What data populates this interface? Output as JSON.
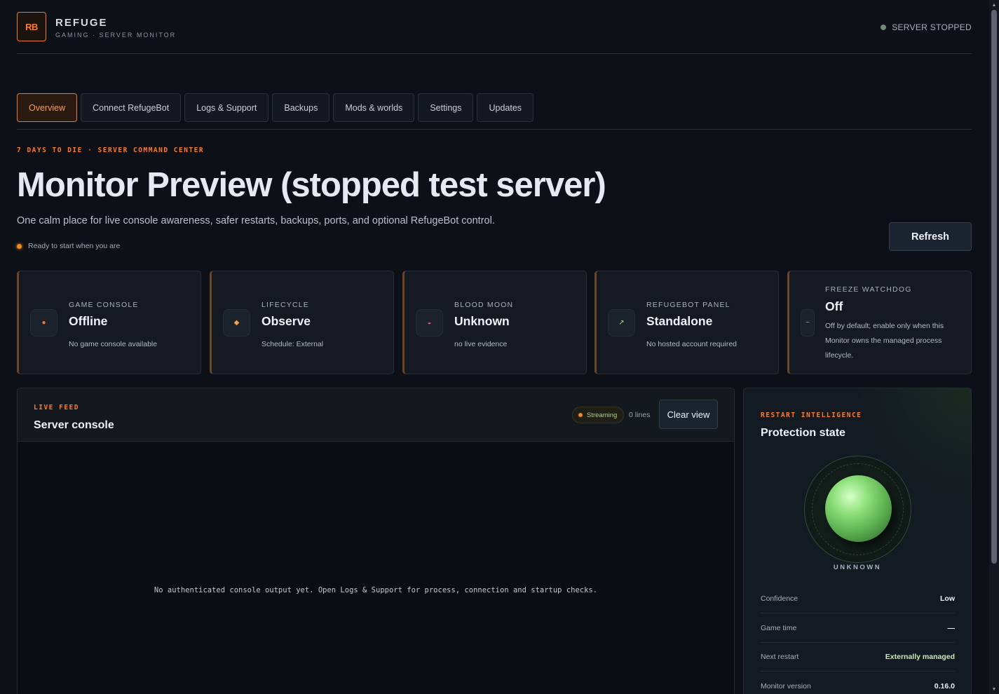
{
  "brand": {
    "logo": "RB",
    "title": "REFUGE",
    "subtitle": "GAMING · SERVER MONITOR"
  },
  "server_status": {
    "label": "SERVER STOPPED",
    "color": "#6f8a75"
  },
  "tabs": [
    {
      "label": "Overview",
      "active": true
    },
    {
      "label": "Connect RefugeBot",
      "active": false
    },
    {
      "label": "Logs & Support",
      "active": false
    },
    {
      "label": "Backups",
      "active": false
    },
    {
      "label": "Mods & worlds",
      "active": false
    },
    {
      "label": "Settings",
      "active": false
    },
    {
      "label": "Updates",
      "active": false
    }
  ],
  "hero": {
    "eyebrow": "7 DAYS TO DIE · SERVER COMMAND CENTER",
    "title": "Monitor Preview (stopped test server)",
    "description": "One calm place for live console awareness, safer restarts, backups, ports, and optional RefugeBot control.",
    "ready_text": "Ready to start when you are",
    "refresh_label": "Refresh"
  },
  "cards": [
    {
      "label": "GAME CONSOLE",
      "value": "Offline",
      "detail": "No game console available",
      "icon": "dot-icon",
      "glyph": "●",
      "color": "#f0782a"
    },
    {
      "label": "LIFECYCLE",
      "value": "Observe",
      "detail": "Schedule: External",
      "icon": "diamond-icon",
      "glyph": "◆",
      "color": "#f2a04a"
    },
    {
      "label": "BLOOD MOON",
      "value": "Unknown",
      "detail": "no live evidence",
      "icon": "moon-icon",
      "glyph": "◒",
      "color": "#e55a6a"
    },
    {
      "label": "REFUGEBOT PANEL",
      "value": "Standalone",
      "detail": "No hosted account required",
      "icon": "link-arrow-icon",
      "glyph": "↗",
      "color": "#a9d86a"
    },
    {
      "label": "FREEZE WATCHDOG",
      "value": "Off",
      "detail": "Off by default; enable only when this Monitor owns the managed process lifecycle.",
      "icon": "watchdog-icon",
      "glyph": "~",
      "color": "#f2a04a"
    }
  ],
  "console": {
    "eyebrow": "LIVE FEED",
    "title": "Server console",
    "streaming_label": "Streaming",
    "lines_label": "0 lines",
    "clear_label": "Clear view",
    "empty_text": "No authenticated console output yet. Open Logs & Support for process, connection and startup checks."
  },
  "restart": {
    "eyebrow": "RESTART INTELLIGENCE",
    "title": "Protection state",
    "orb_label": "UNKNOWN",
    "rows": [
      {
        "key": "Confidence",
        "value": "Low"
      },
      {
        "key": "Game time",
        "value": "—"
      },
      {
        "key": "Next restart",
        "value": "Externally managed"
      },
      {
        "key": "Monitor version",
        "value": "0.16.0"
      }
    ]
  }
}
